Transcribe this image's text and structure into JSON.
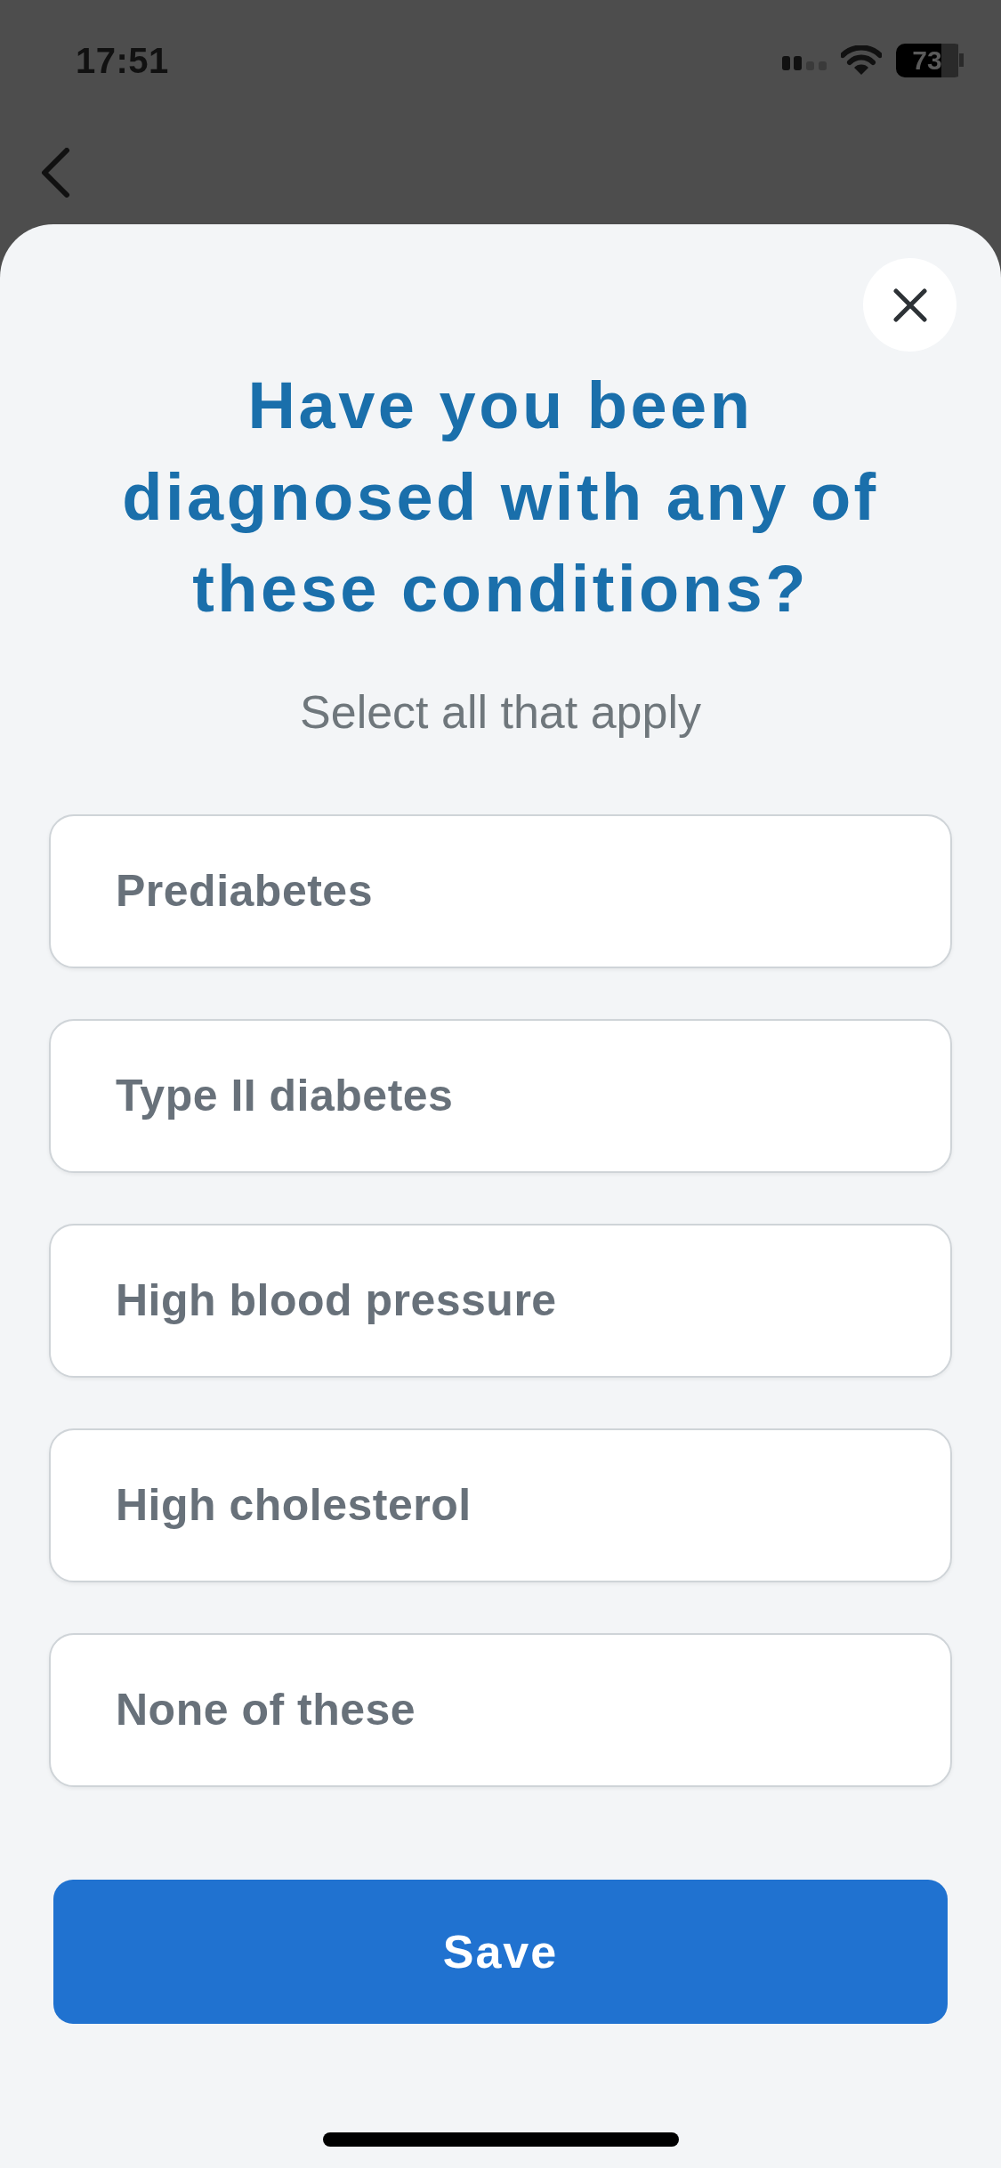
{
  "status_bar": {
    "time": "17:51",
    "battery": "73"
  },
  "sheet": {
    "title": "Have you been diagnosed with any of these conditions?",
    "subtitle": "Select all that apply",
    "options": [
      {
        "label": "Prediabetes",
        "selected": false
      },
      {
        "label": "Type II diabetes",
        "selected": false
      },
      {
        "label": "High blood pressure",
        "selected": false
      },
      {
        "label": "High cholesterol",
        "selected": false
      },
      {
        "label": "None of these",
        "selected": false
      }
    ],
    "save_button": "Save"
  }
}
